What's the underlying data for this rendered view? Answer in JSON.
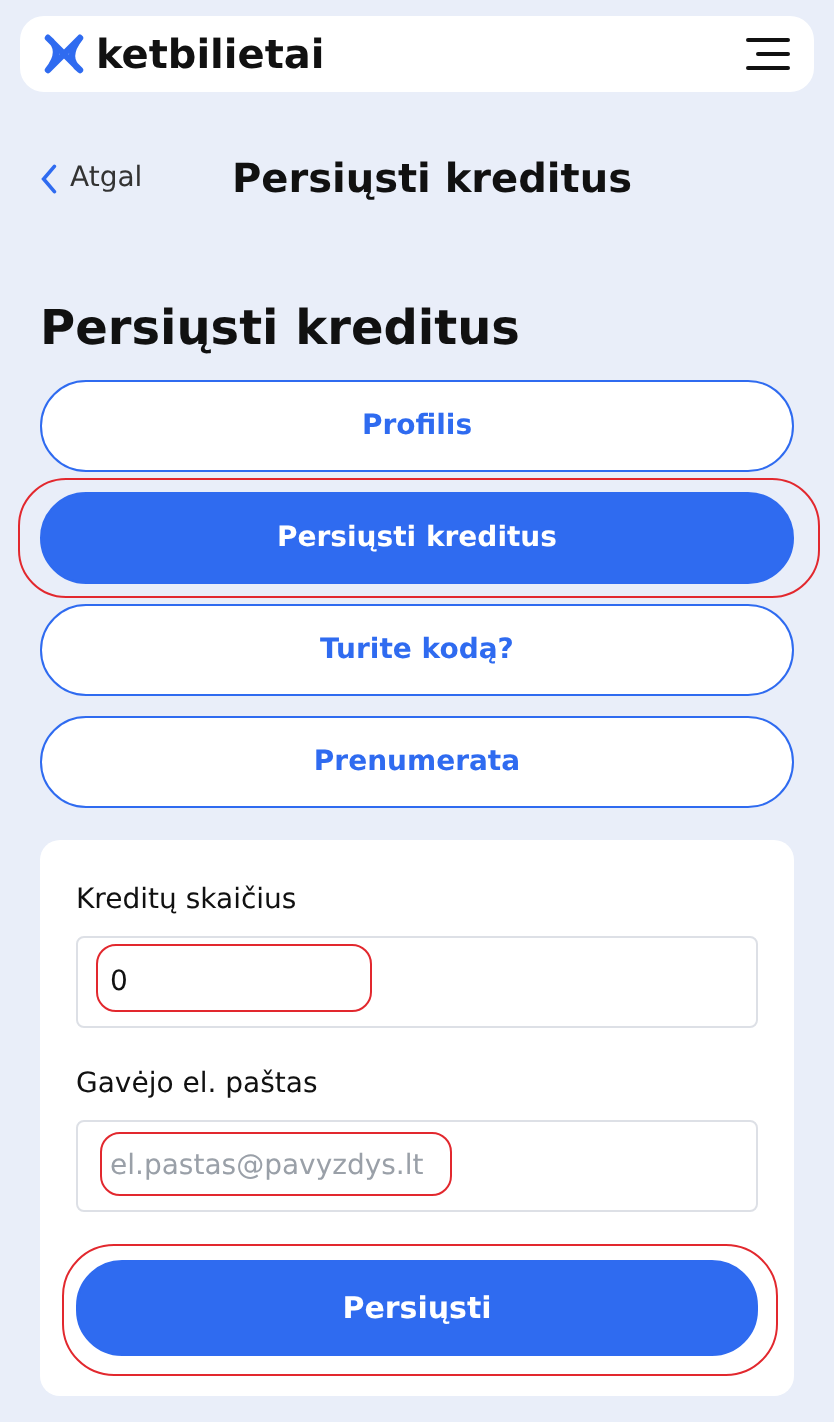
{
  "header": {
    "logo": "ketbilietai"
  },
  "nav": {
    "back": "Atgal",
    "title": "Persiųsti kreditus"
  },
  "heading": "Persiųsti kreditus",
  "menu": [
    {
      "label": "Profilis",
      "selected": false,
      "highlighted": false
    },
    {
      "label": "Persiųsti kreditus",
      "selected": true,
      "highlighted": true
    },
    {
      "label": "Turite kodą?",
      "selected": false,
      "highlighted": false
    },
    {
      "label": "Prenumerata",
      "selected": false,
      "highlighted": false
    }
  ],
  "form": {
    "fields": [
      {
        "label": "Kreditų skaičius",
        "value": "0",
        "highlighted": true
      },
      {
        "label": "Gavėjo el. paštas",
        "placeholder": "el.pastas@pavyzdys.lt",
        "highlighted": true
      }
    ],
    "submit": {
      "label": "Persiųsti",
      "highlighted": true
    }
  }
}
